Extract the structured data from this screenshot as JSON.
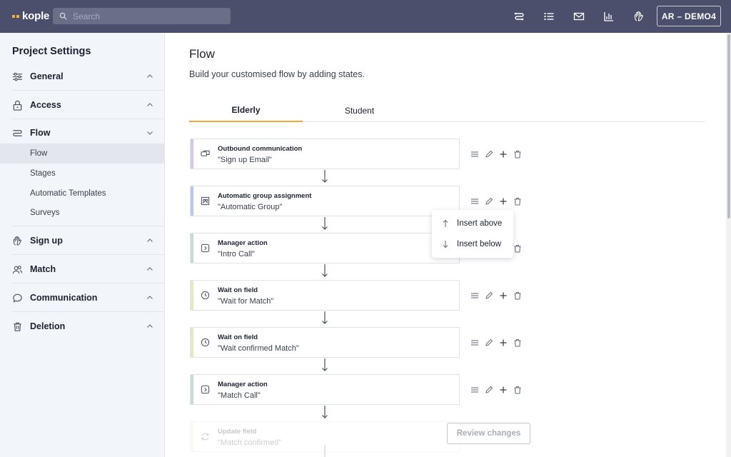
{
  "app": {
    "logo_text": "kople",
    "brand_accent": "#f2b233",
    "topbar_color": "#4b4f6b"
  },
  "search": {
    "placeholder": "Search",
    "value": ""
  },
  "topbar": {
    "icons": [
      "flow-icon",
      "list-icon",
      "mail-icon",
      "chart-icon",
      "hand-icon"
    ],
    "user_label": "AR – DEMO4"
  },
  "sidebar": {
    "title": "Project Settings",
    "sections": [
      {
        "label": "General",
        "icon": "sliders-icon",
        "expanded": false
      },
      {
        "label": "Access",
        "icon": "lock-icon",
        "expanded": false
      },
      {
        "label": "Flow",
        "icon": "flow-icon",
        "expanded": true,
        "items": [
          {
            "label": "Flow",
            "active": true
          },
          {
            "label": "Stages",
            "active": false
          },
          {
            "label": "Automatic Templates",
            "active": false
          },
          {
            "label": "Surveys",
            "active": false
          }
        ]
      },
      {
        "label": "Sign up",
        "icon": "hand-icon",
        "expanded": false
      },
      {
        "label": "Match",
        "icon": "users-icon",
        "expanded": false
      },
      {
        "label": "Communication",
        "icon": "chat-icon",
        "expanded": false
      },
      {
        "label": "Deletion",
        "icon": "trash-icon",
        "expanded": false
      }
    ]
  },
  "main": {
    "title": "Flow",
    "subtitle": "Build your customised flow by adding states.",
    "tabs": [
      {
        "label": "Elderly",
        "active": true
      },
      {
        "label": "Student",
        "active": false
      }
    ],
    "states": [
      {
        "type": "Outbound communication",
        "name": "\"Sign up Email\"",
        "color": "#d7c7e6",
        "icon": "outbound-icon"
      },
      {
        "type": "Automatic group assignment",
        "name": "\"Automatic Group\"",
        "color": "#b9c9ea",
        "icon": "group-icon"
      },
      {
        "type": "Manager action",
        "name": "\"Intro Call\"",
        "color": "#c8dbd8",
        "icon": "manager-action-icon"
      },
      {
        "type": "Wait on field",
        "name": "\"Wait for Match\"",
        "color": "#dfeac2",
        "icon": "clock-icon"
      },
      {
        "type": "Wait on field",
        "name": "\"Wait confirmed Match\"",
        "color": "#dfeac2",
        "icon": "clock-icon"
      },
      {
        "type": "Manager action",
        "name": "\"Match Call\"",
        "color": "#c8dbd8",
        "icon": "manager-action-icon"
      },
      {
        "type": "Update field",
        "name": "\"Match confirmed\"",
        "color": "#f2ecc8",
        "icon": "update-icon"
      }
    ],
    "insert_menu": {
      "above": "Insert above",
      "below": "Insert below"
    },
    "review_button": "Review changes"
  }
}
